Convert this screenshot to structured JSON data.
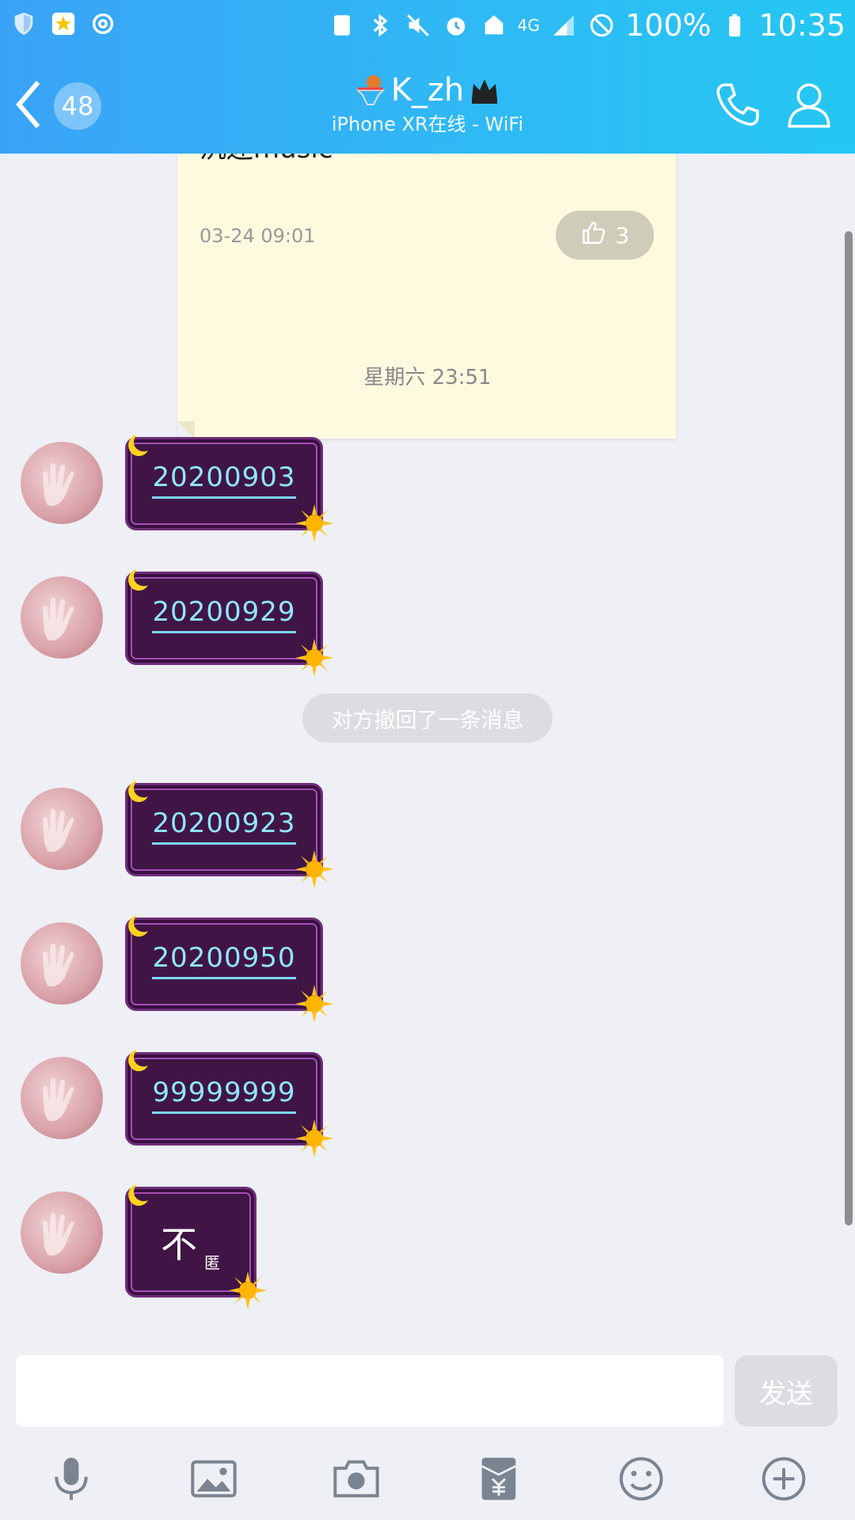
{
  "status_bar": {
    "battery_percent": "100%",
    "time": "10:35",
    "network": "4G"
  },
  "header": {
    "unread_count": "48",
    "contact_name": "K_zh",
    "contact_status": "iPhone XR在线 - WiFi"
  },
  "note_card": {
    "text": "沉迷music",
    "timestamp": "03-24 09:01",
    "like_count": "3"
  },
  "chat": {
    "time_separator": "星期六 23:51",
    "recall_notice": "对方撤回了一条消息",
    "messages": [
      {
        "text": "20200903"
      },
      {
        "text": "20200929"
      },
      {
        "text": "20200923"
      },
      {
        "text": "20200950"
      },
      {
        "text": "99999999"
      },
      {
        "text": "不",
        "small_text": "匿"
      }
    ]
  },
  "input": {
    "value": "",
    "send_label": "发送"
  },
  "toolbar": {
    "icons": [
      "microphone-icon",
      "image-icon",
      "camera-icon",
      "red-packet-icon",
      "emoji-icon",
      "plus-icon"
    ]
  },
  "colors": {
    "header_start": "#3aa3f6",
    "header_end": "#25c7f2",
    "bubble_bg": "#401545",
    "bubble_text": "#8fe7ff"
  }
}
